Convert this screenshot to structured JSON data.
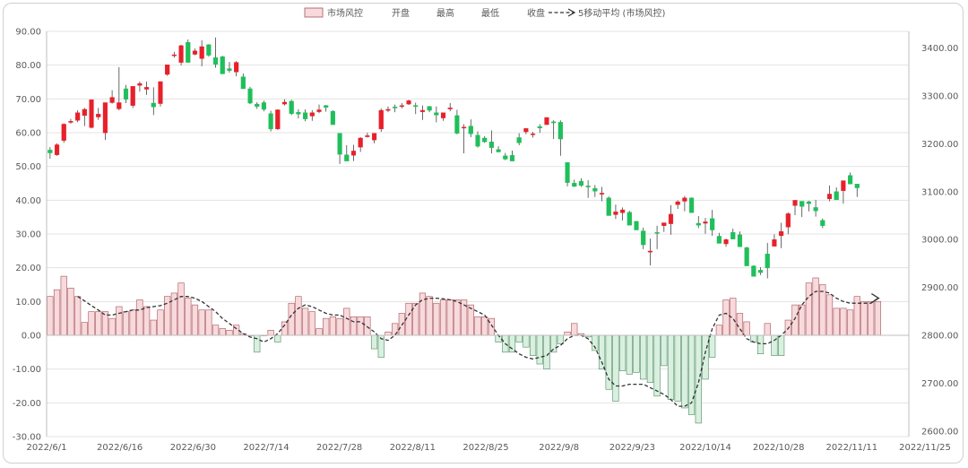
{
  "chart_data": {
    "type": "candlestick+bar+line",
    "legend": {
      "items": [
        {
          "label": "市场风控",
          "kind": "bar"
        },
        {
          "label": "开盘",
          "kind": "text"
        },
        {
          "label": "最高",
          "kind": "text"
        },
        {
          "label": "最低",
          "kind": "text"
        },
        {
          "label": "收盘",
          "kind": "text"
        },
        {
          "label": "5移动平均 (市场风控)",
          "kind": "trendline"
        }
      ],
      "position": "top"
    },
    "colors": {
      "up": "#e8202a",
      "down": "#1fbf5a",
      "bar_pos_fill": "#f8d9dc",
      "bar_pos_stroke": "#a4545a",
      "bar_neg_fill": "#d9f0e0",
      "bar_neg_stroke": "#4f8a62",
      "trend": "#333333",
      "grid": "#e3e3e3"
    },
    "left_axis": {
      "ticks": [
        "90.00",
        "80.00",
        "70.00",
        "60.00",
        "50.00",
        "40.00",
        "30.00",
        "20.00",
        "10.00",
        "0.00",
        "-10.00",
        "-20.00",
        "-30.00"
      ],
      "range": [
        -30,
        90
      ]
    },
    "right_axis": {
      "ticks": [
        "3400.00",
        "3300.00",
        "3200.00",
        "3100.00",
        "3000.00",
        "2900.00",
        "2800.00",
        "2700.00",
        "2600.00"
      ],
      "range": [
        2600,
        3400
      ],
      "range_note": "left 0 aligns with 2800"
    },
    "x_axis": {
      "ticks": [
        "2022/6/1",
        "2022/6/16",
        "2022/6/30",
        "2022/7/14",
        "2022/7/28",
        "2022/8/11",
        "2022/8/25",
        "2022/9/8",
        "2022/9/23",
        "2022/10/14",
        "2022/10/28",
        "2022/11/11",
        "2022/11/25"
      ],
      "n_slots": 125
    },
    "grid": true,
    "candles": [
      [
        3187,
        3193,
        3169,
        3181
      ],
      [
        3177,
        3201,
        3175,
        3198
      ],
      [
        3207,
        3243,
        3202,
        3241
      ],
      [
        3245,
        3252,
        3242,
        3247
      ],
      [
        3249,
        3270,
        3245,
        3265
      ],
      [
        3259,
        3275,
        3237,
        3272
      ],
      [
        3234,
        3292,
        3232,
        3292
      ],
      [
        3256,
        3275,
        3250,
        3262
      ],
      [
        3223,
        3279,
        3208,
        3286
      ],
      [
        3286,
        3312,
        3284,
        3297
      ],
      [
        3273,
        3360,
        3270,
        3286
      ],
      [
        3315,
        3323,
        3285,
        3293
      ],
      [
        3280,
        3317,
        3275,
        3320
      ],
      [
        3322,
        3330,
        3309,
        3326
      ],
      [
        3314,
        3330,
        3302,
        3318
      ],
      [
        3285,
        3318,
        3260,
        3277
      ],
      [
        3284,
        3320,
        3278,
        3330
      ],
      [
        3345,
        3360,
        3342,
        3365
      ],
      [
        3384,
        3392,
        3380,
        3386
      ],
      [
        3370,
        3407,
        3364,
        3405
      ],
      [
        3412,
        3418,
        3373,
        3370
      ],
      [
        3387,
        3399,
        3385,
        3394
      ],
      [
        3378,
        3416,
        3362,
        3403
      ],
      [
        3407,
        3408,
        3382,
        3385
      ],
      [
        3380,
        3422,
        3359,
        3366
      ],
      [
        3382,
        3384,
        3362,
        3346
      ],
      [
        3357,
        3371,
        3349,
        3353
      ],
      [
        3350,
        3373,
        3341,
        3370
      ],
      [
        3340,
        3347,
        3315,
        3315
      ],
      [
        3315,
        3319,
        3283,
        3285
      ],
      [
        3283,
        3287,
        3273,
        3278
      ],
      [
        3286,
        3290,
        3268,
        3272
      ],
      [
        3263,
        3269,
        3226,
        3231
      ],
      [
        3231,
        3272,
        3229,
        3271
      ],
      [
        3283,
        3293,
        3280,
        3287
      ],
      [
        3289,
        3292,
        3260,
        3263
      ],
      [
        3266,
        3272,
        3253,
        3262
      ],
      [
        3265,
        3272,
        3247,
        3252
      ],
      [
        3258,
        3270,
        3248,
        3265
      ],
      [
        3267,
        3282,
        3264,
        3271
      ],
      [
        3280,
        3281,
        3267,
        3276
      ],
      [
        3268,
        3270,
        3244,
        3240
      ],
      [
        3222,
        3218,
        3158,
        3178
      ],
      [
        3177,
        3197,
        3166,
        3164
      ],
      [
        3176,
        3198,
        3164,
        3185
      ],
      [
        3193,
        3214,
        3183,
        3212
      ],
      [
        3215,
        3223,
        3213,
        3217
      ],
      [
        3208,
        3222,
        3201,
        3222
      ],
      [
        3231,
        3274,
        3225,
        3270
      ],
      [
        3272,
        3278,
        3266,
        3272
      ],
      [
        3277,
        3282,
        3266,
        3276
      ],
      [
        3278,
        3285,
        3274,
        3280
      ],
      [
        3283,
        3292,
        3281,
        3290
      ],
      [
        3280,
        3286,
        3262,
        3278
      ],
      [
        3267,
        3280,
        3250,
        3270
      ],
      [
        3278,
        3279,
        3266,
        3270
      ],
      [
        3265,
        3278,
        3245,
        3260
      ],
      [
        3254,
        3265,
        3248,
        3265
      ],
      [
        3274,
        3285,
        3268,
        3275
      ],
      [
        3259,
        3271,
        3220,
        3222
      ],
      [
        3235,
        3241,
        3180,
        3235
      ],
      [
        3237,
        3251,
        3214,
        3221
      ],
      [
        3218,
        3226,
        3192,
        3195
      ],
      [
        3212,
        3216,
        3202,
        3204
      ],
      [
        3204,
        3228,
        3180,
        3192
      ],
      [
        3188,
        3195,
        3182,
        3183
      ],
      [
        3175,
        3181,
        3166,
        3168
      ],
      [
        3176,
        3186,
        3165,
        3164
      ],
      [
        3213,
        3222,
        3197,
        3202
      ],
      [
        3225,
        3230,
        3220,
        3232
      ],
      [
        3220,
        3225,
        3213,
        3221
      ],
      [
        3236,
        3241,
        3223,
        3233
      ],
      [
        3240,
        3254,
        3247,
        3255
      ],
      [
        3246,
        3249,
        3210,
        3245
      ],
      [
        3245,
        3249,
        3175,
        3210
      ],
      [
        3161,
        3160,
        3111,
        3119
      ],
      [
        3118,
        3125,
        3110,
        3111
      ],
      [
        3122,
        3128,
        3110,
        3113
      ],
      [
        3112,
        3124,
        3087,
        3111
      ],
      [
        3107,
        3114,
        3089,
        3101
      ],
      [
        3097,
        3110,
        3080,
        3097
      ],
      [
        3087,
        3090,
        3057,
        3050
      ],
      [
        3052,
        3073,
        3043,
        3058
      ],
      [
        3056,
        3067,
        3040,
        3062
      ],
      [
        3057,
        3060,
        3031,
        3030
      ],
      [
        3038,
        3039,
        3020,
        3020
      ],
      [
        3018,
        3025,
        2980,
        2989
      ],
      [
        2975,
        3002,
        2946,
        2976
      ],
      [
        3015,
        3029,
        2980,
        3014
      ],
      [
        3029,
        3029,
        3016,
        3035
      ],
      [
        3033,
        3072,
        3010,
        3053
      ],
      [
        3073,
        3082,
        3064,
        3079
      ],
      [
        3080,
        3091,
        3059,
        3087
      ],
      [
        3087,
        3088,
        3066,
        3056
      ],
      [
        3034,
        3049,
        3024,
        3030
      ],
      [
        3034,
        3045,
        3012,
        3037
      ],
      [
        3044,
        3062,
        3008,
        3020
      ],
      [
        3007,
        3014,
        3004,
        2992
      ],
      [
        2991,
        3002,
        2985,
        3000
      ],
      [
        3015,
        3023,
        3008,
        3001
      ],
      [
        3010,
        3017,
        2996,
        2985
      ],
      [
        2983,
        2985,
        2950,
        2945
      ],
      [
        2945,
        2946,
        2925,
        2923
      ],
      [
        2936,
        2942,
        2926,
        2931
      ],
      [
        2970,
        2993,
        2919,
        2941
      ],
      [
        2986,
        3011,
        2990,
        3000
      ],
      [
        3008,
        3035,
        2982,
        3017
      ],
      [
        3026,
        3057,
        3011,
        3054
      ],
      [
        3071,
        3081,
        3051,
        3082
      ],
      [
        3080,
        3079,
        3047,
        3069
      ],
      [
        3079,
        3081,
        3059,
        3075
      ],
      [
        3067,
        3083,
        3048,
        3060
      ],
      [
        3040,
        3044,
        3024,
        3029
      ],
      [
        3085,
        3113,
        3080,
        3095
      ],
      [
        3100,
        3109,
        3083,
        3083
      ],
      [
        3102,
        3117,
        3075,
        3123
      ],
      [
        3134,
        3140,
        3123,
        3116
      ],
      [
        3116,
        3112,
        3089,
        3108
      ]
    ],
    "bars": [
      11.5,
      13.5,
      17.5,
      14,
      11.5,
      3.8,
      7,
      7,
      7,
      5,
      8.5,
      7,
      7.5,
      10.5,
      8.5,
      4.5,
      7.5,
      11.5,
      12.5,
      15.5,
      11,
      9,
      7.5,
      7.5,
      3,
      2,
      1.5,
      3,
      0.5,
      0,
      -5,
      0,
      1.5,
      -2,
      4,
      9.5,
      11.5,
      8,
      7,
      2,
      5,
      5.5,
      5,
      8,
      5.5,
      5.5,
      5.5,
      -4,
      -6.5,
      1,
      3.5,
      6.5,
      9.5,
      9.5,
      12.5,
      11.5,
      9.5,
      10.5,
      10.5,
      10.5,
      10.5,
      9,
      5.5,
      5.5,
      5,
      -2,
      -5,
      -5,
      -2,
      -3.5,
      -6,
      -8.5,
      -10,
      -5,
      -2.5,
      1,
      3.5,
      0.5,
      -0.5,
      -4.5,
      -10,
      -16,
      -19.5,
      -10.5,
      -11.5,
      -11,
      -13,
      -14,
      -18,
      -9,
      -19,
      -19.5,
      -21.5,
      -23.5,
      -26,
      -13,
      -6.5,
      3,
      10.5,
      11,
      6.5,
      4,
      -2,
      -5.5,
      3.5,
      -6,
      -6,
      4.5,
      9,
      9,
      15.5,
      17,
      15,
      12,
      8,
      8,
      7.5,
      11.5,
      10,
      10,
      10
    ],
    "ma5": [
      null,
      null,
      null,
      null,
      11.5,
      10.2,
      8.8,
      7.5,
      6,
      6,
      6.5,
      7,
      7.5,
      7.5,
      8.2,
      8.5,
      8.8,
      9.5,
      10.5,
      11.5,
      11.5,
      11,
      10,
      8.5,
      7,
      5,
      3.5,
      2,
      0.5,
      -0.5,
      -1,
      -2,
      -1,
      0.5,
      3,
      6,
      8,
      9,
      8.5,
      7.5,
      6.5,
      6,
      6,
      5,
      4,
      4,
      2.5,
      1,
      -1,
      -1.5,
      0,
      3,
      6,
      9,
      10.5,
      11,
      11,
      10.8,
      10.5,
      10,
      9,
      8,
      7,
      6,
      3,
      0,
      -2.5,
      -4,
      -5.5,
      -6.5,
      -7,
      -6.5,
      -6,
      -4,
      -3,
      -1,
      0,
      0,
      -1,
      -3.5,
      -8,
      -13,
      -15,
      -15,
      -14.5,
      -14.5,
      -14.5,
      -15.5,
      -16.5,
      -17.5,
      -19,
      -21,
      -21,
      -20,
      -14,
      -5,
      2,
      6,
      6.5,
      5,
      2,
      -1,
      -2,
      -2.5,
      -2.5,
      -1.5,
      0,
      2,
      5,
      9,
      11.5,
      13,
      13,
      12.5,
      11,
      10,
      9.5,
      9.5,
      9.5,
      9.5,
      11
    ]
  }
}
